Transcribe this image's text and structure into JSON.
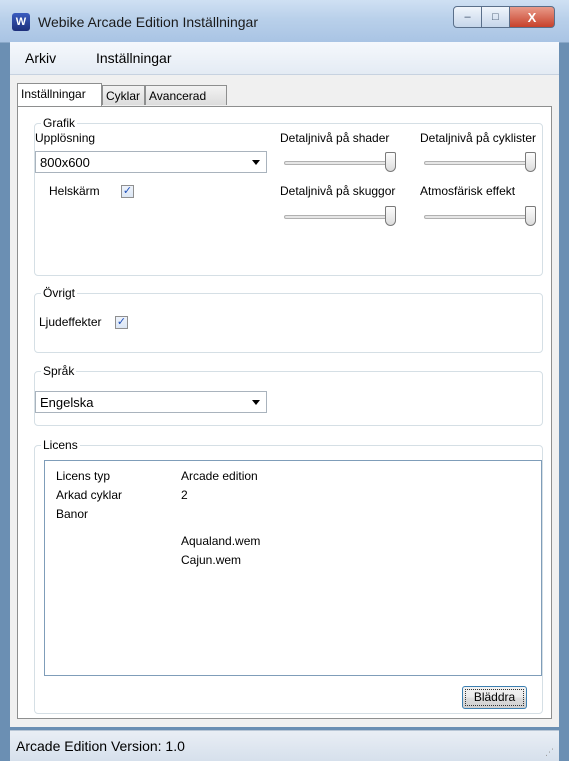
{
  "window": {
    "title": "Webike Arcade Edition Inställningar",
    "caption": {
      "minimize": "–",
      "maximize": "□",
      "close": "X"
    }
  },
  "menu": {
    "file": "Arkiv",
    "settings": "Inställningar"
  },
  "tabs": [
    "Inställningar",
    "Cyklar",
    "Avancerad"
  ],
  "graphics": {
    "title": "Grafik",
    "resolution_label": "Upplösning",
    "resolution_value": "800x600",
    "fullscreen_label": "Helskärm",
    "fullscreen_checked": true,
    "shader_label": "Detaljnivå på shader",
    "cyclist_label": "Detaljnivå på cyklister",
    "shadow_label": "Detaljnivå på skuggor",
    "atmosphere_label": "Atmosfärisk effekt",
    "shader_level": 1.0,
    "cyclist_level": 1.0,
    "shadow_level": 1.0,
    "atmosphere_level": 1.0
  },
  "other": {
    "title": "Övrigt",
    "sound_label": "Ljudeffekter",
    "sound_checked": true
  },
  "language": {
    "title": "Språk",
    "value": "Engelska"
  },
  "license": {
    "title": "Licens",
    "rows": [
      {
        "key": "Licens typ",
        "value": "Arcade edition"
      },
      {
        "key": "Arkad cyklar",
        "value": "2"
      },
      {
        "key": "Banor",
        "value": ""
      }
    ],
    "tracks": [
      "Aqualand.wem",
      "Cajun.wem"
    ],
    "browse_button": "Bläddra"
  },
  "status": {
    "text": "Arcade Edition Version: 1.0"
  },
  "glyphs": {
    "check": "✓",
    "grip": "⋰"
  }
}
